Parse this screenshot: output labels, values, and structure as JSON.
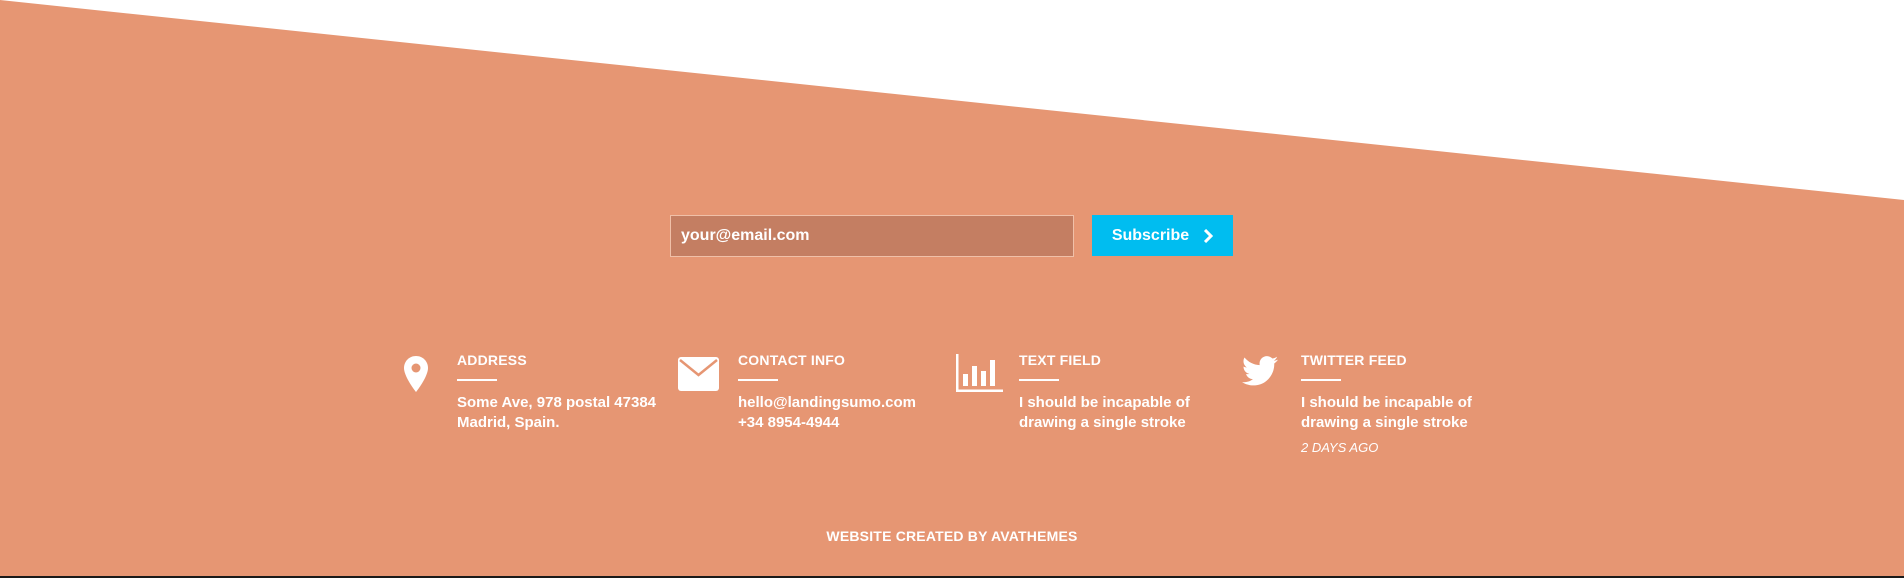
{
  "colors": {
    "background": "#e69673",
    "accent_button": "#00bdf0",
    "input_fill": "#c47e62",
    "text": "#ffffff"
  },
  "subscribe": {
    "email_placeholder": "your@email.com",
    "button_label": "Subscribe",
    "button_icon": "chevron-right-icon"
  },
  "info": [
    {
      "icon": "map-pin-icon",
      "title": "ADDRESS",
      "lines": [
        "Some Ave, 978 postal 47384",
        "Madrid, Spain."
      ]
    },
    {
      "icon": "envelope-icon",
      "title": "CONTACT INFO",
      "lines": [
        "hello@landingsumo.com",
        "+34 8954-4944"
      ]
    },
    {
      "icon": "bar-chart-icon",
      "title": "TEXT FIELD",
      "lines": [
        "I should be incapable of",
        "drawing a single stroke"
      ]
    },
    {
      "icon": "twitter-icon",
      "title": "TWITTER FEED",
      "lines": [
        "I should be incapable of",
        "drawing a single stroke"
      ],
      "time": "2 DAYS AGO"
    }
  ],
  "footer": {
    "credit": "WEBSITE CREATED BY AVATHEMES"
  }
}
